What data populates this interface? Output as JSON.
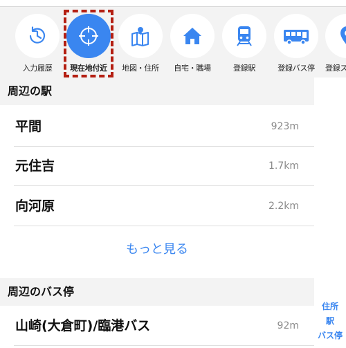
{
  "shortcuts": [
    {
      "label": "入力履歴",
      "icon": "history-icon"
    },
    {
      "label": "現在地付近",
      "icon": "current-location-icon",
      "active": true
    },
    {
      "label": "地図・住所",
      "icon": "map-pin-icon"
    },
    {
      "label": "自宅・職場",
      "icon": "home-icon"
    },
    {
      "label": "登録駅",
      "icon": "train-icon"
    },
    {
      "label": "登録バス停",
      "icon": "bus-icon"
    },
    {
      "label": "登録ス",
      "icon": "location-pin-icon"
    }
  ],
  "stations": {
    "header": "周辺の駅",
    "items": [
      {
        "name": "平間",
        "distance": "923m"
      },
      {
        "name": "元住吉",
        "distance": "1.7km"
      },
      {
        "name": "向河原",
        "distance": "2.2km"
      }
    ],
    "more_label": "もっと見る"
  },
  "bus_stops": {
    "header": "周辺のバス停",
    "items": [
      {
        "name": "山崎(大倉町)/臨港バス",
        "distance": "92m"
      }
    ]
  },
  "index": [
    "住所",
    "駅",
    "バス停"
  ],
  "colors": {
    "accent": "#3a86f0",
    "highlight": "#b41f12",
    "background": "#f3f3f3"
  }
}
